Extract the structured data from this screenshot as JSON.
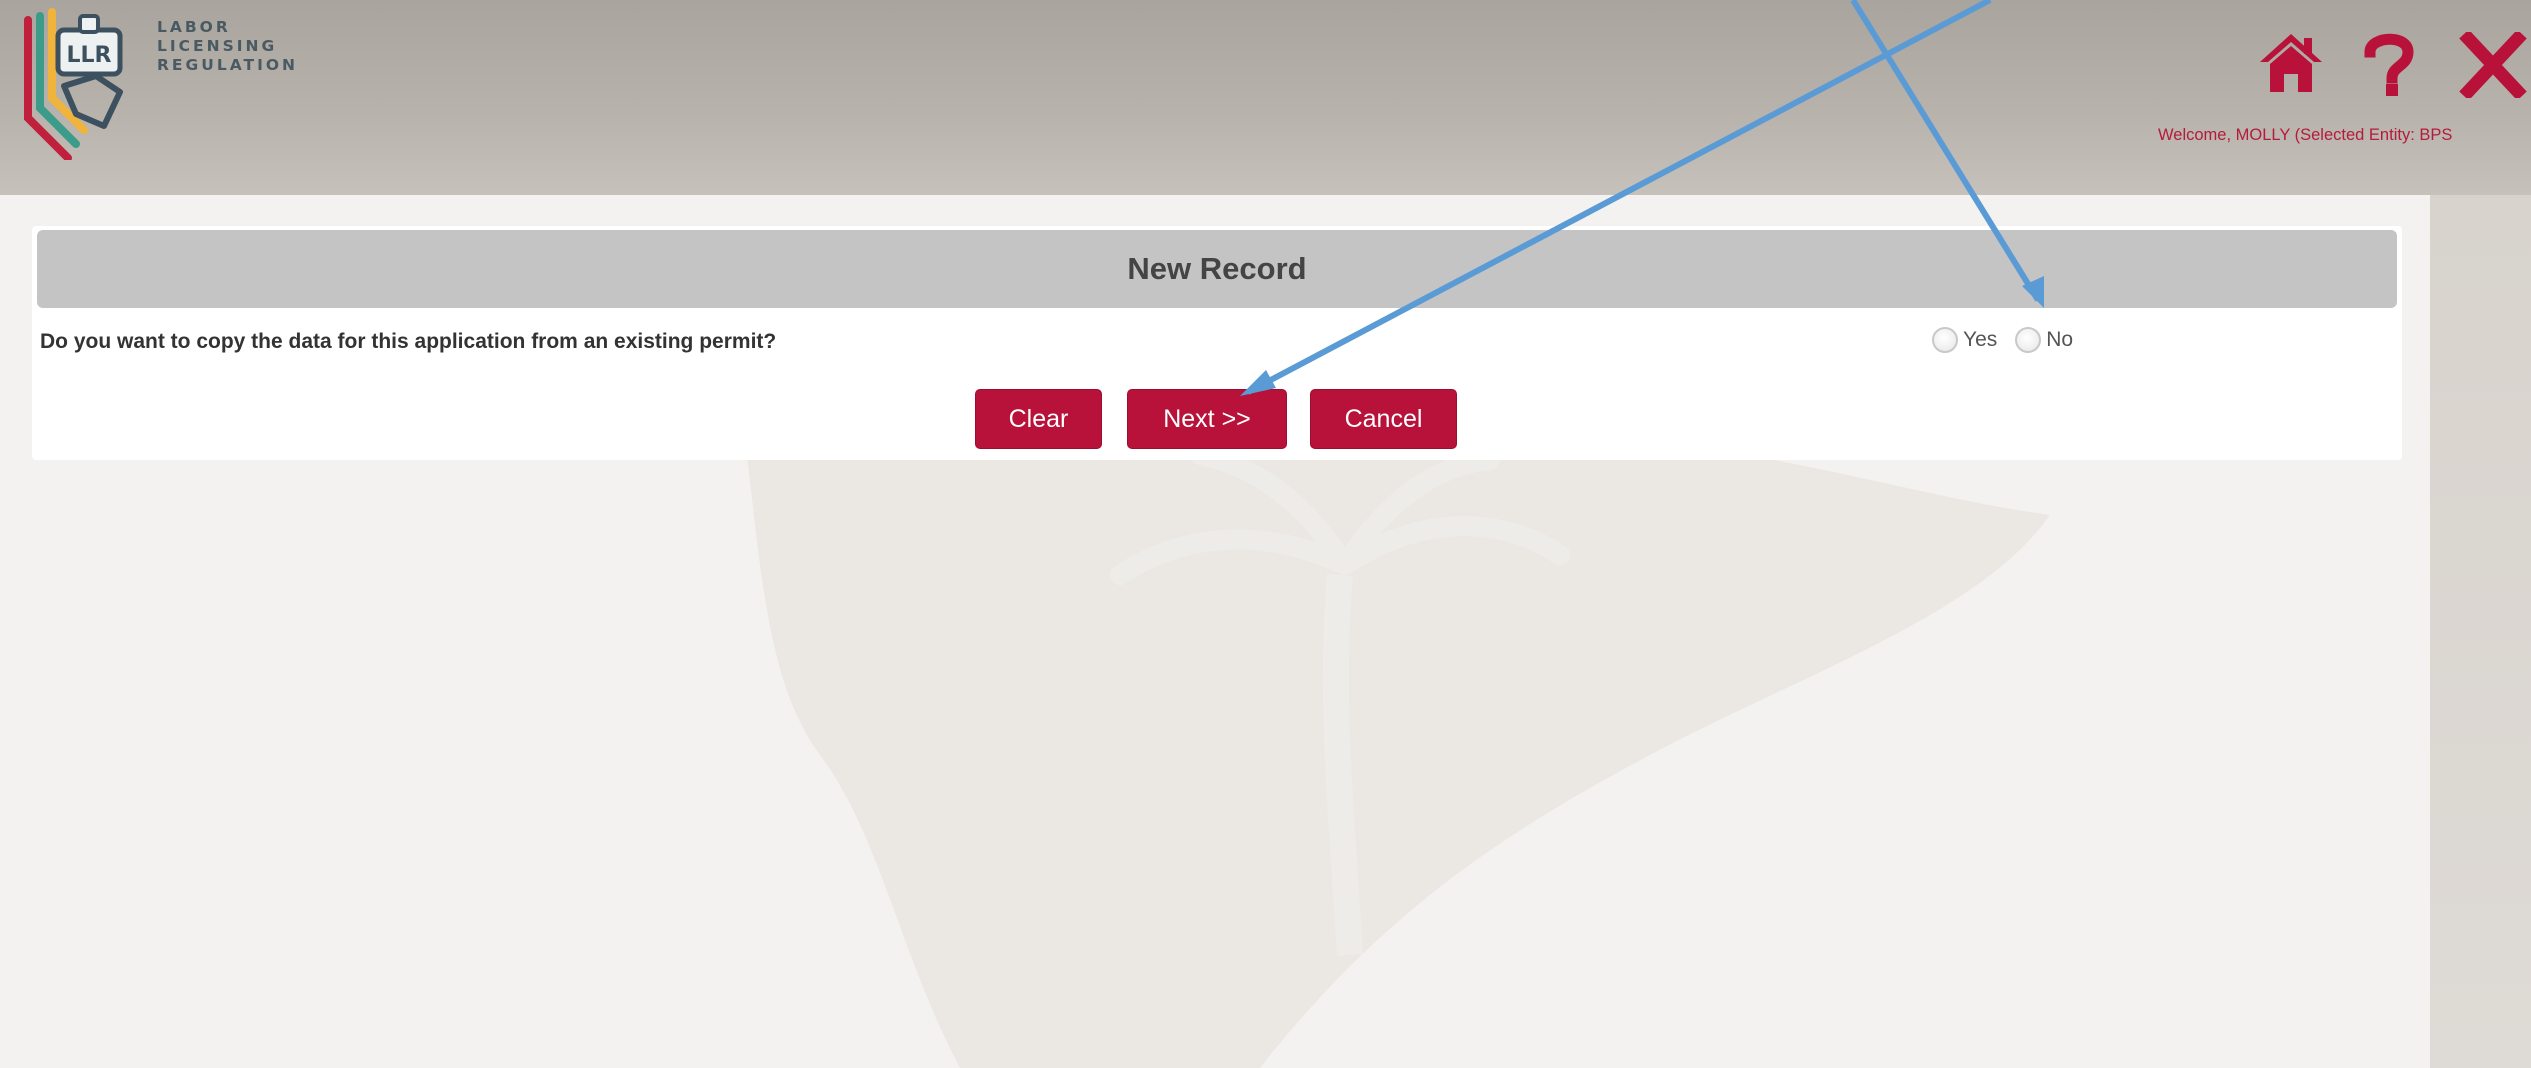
{
  "header": {
    "logo_text": [
      "LABOR",
      "LICENSING",
      "REGULATION"
    ],
    "logo_mark": "LLR",
    "welcome_text": "Welcome, MOLLY (Selected Entity: BPS",
    "icons": [
      "home-icon",
      "help-icon",
      "close-icon"
    ]
  },
  "card": {
    "title": "New Record",
    "question": "Do you want to copy the data for this application from an existing permit?",
    "options": [
      {
        "label": "Yes",
        "selected": false
      },
      {
        "label": "No",
        "selected": false
      }
    ]
  },
  "buttons": {
    "clear": "Clear",
    "next": "Next >>",
    "cancel": "Cancel"
  },
  "colors": {
    "accent": "#b8123a",
    "welcome": "#b51b3b",
    "title_bar": "#c4c4c4",
    "annotation_arrow": "#5b9bd5"
  }
}
